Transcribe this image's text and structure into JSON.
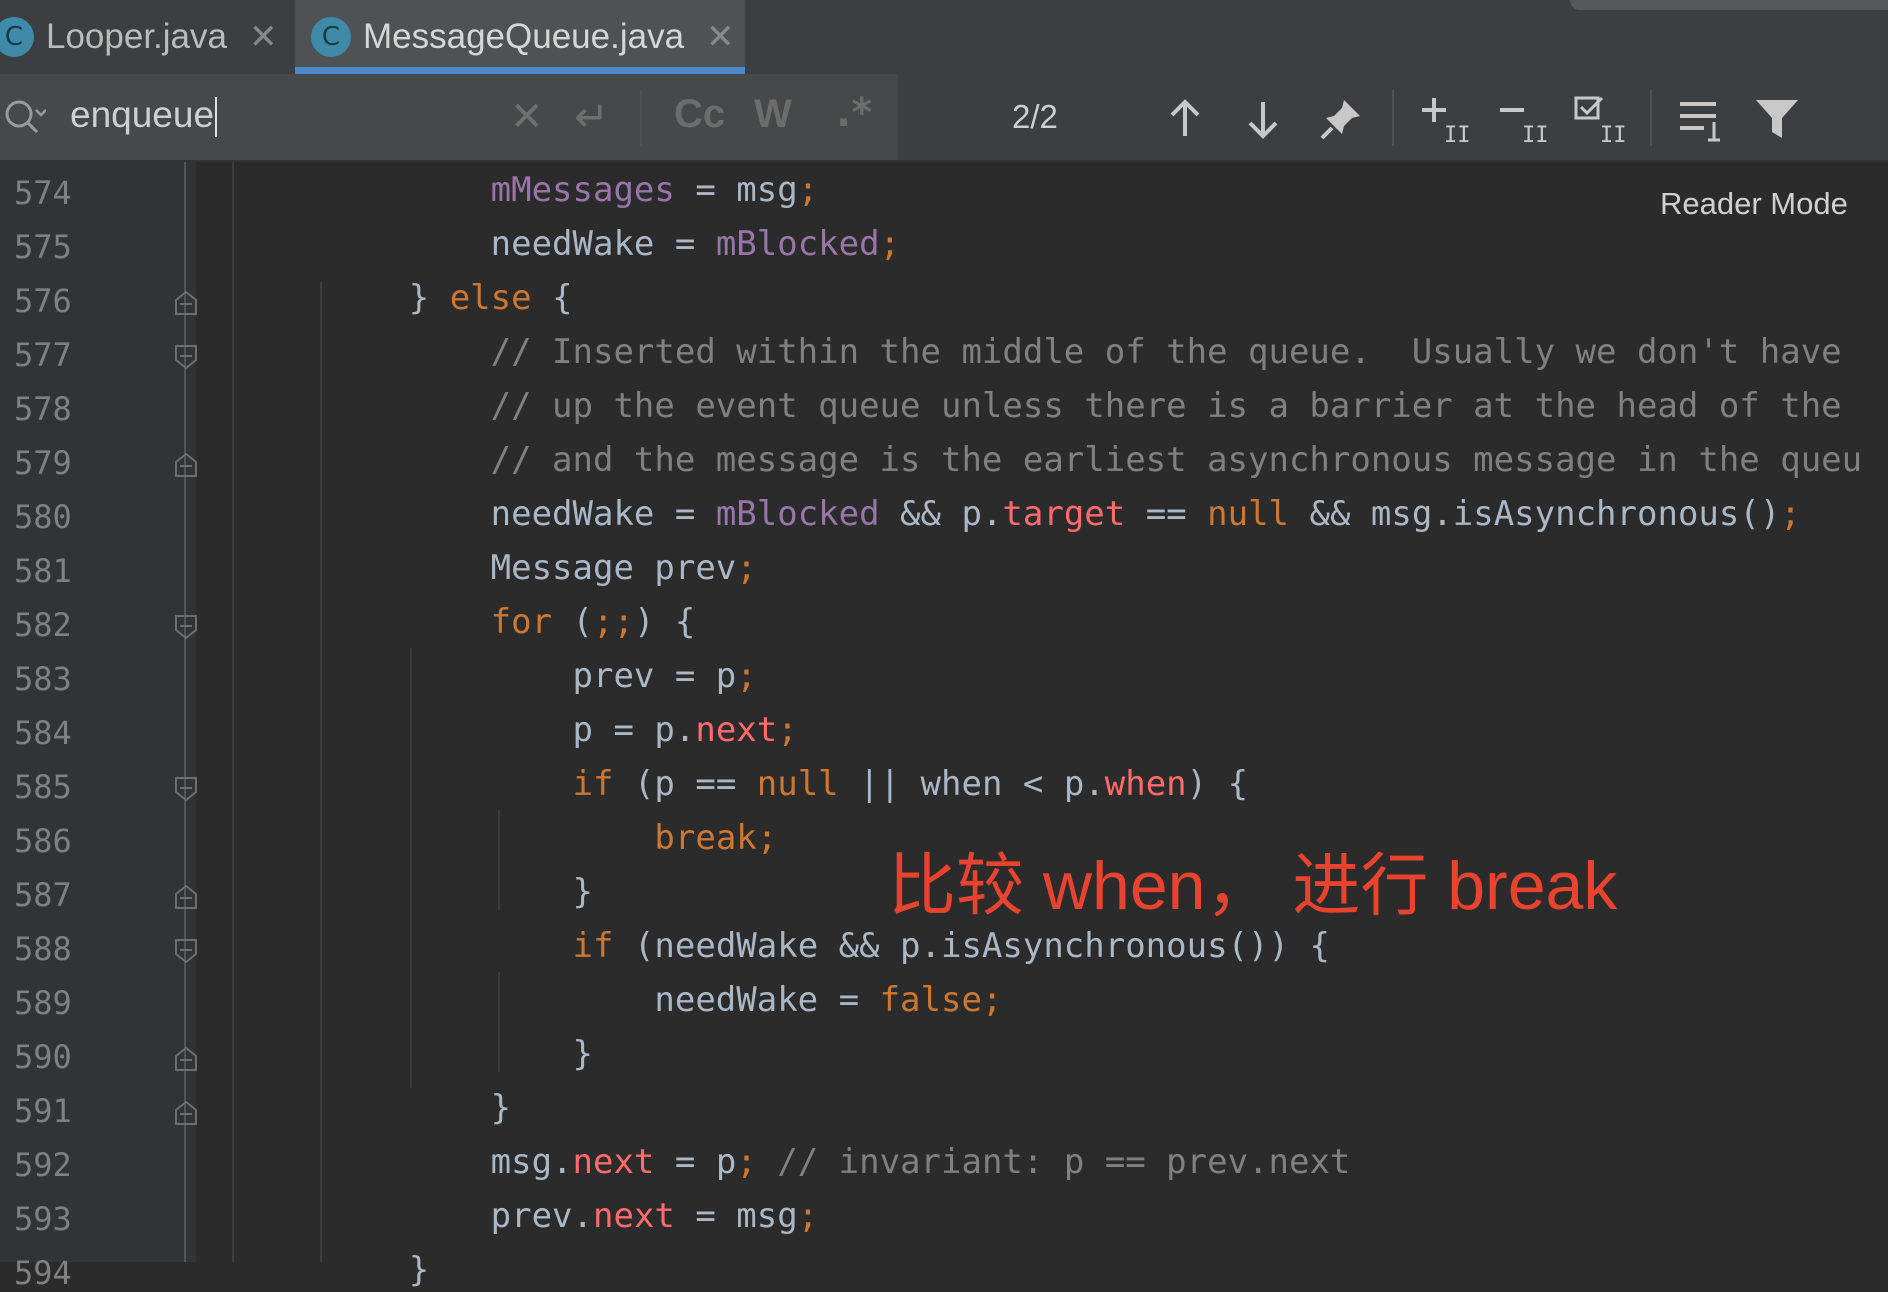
{
  "tabs": [
    {
      "icon": "C",
      "label": "Looper.java"
    },
    {
      "icon": "C",
      "label": "MessageQueue.java"
    }
  ],
  "search": {
    "query": "enqueue",
    "match_case": "Cc",
    "words": "W",
    "regex": ".*",
    "count": "2/2"
  },
  "reader_mode": "Reader Mode",
  "annotation": "比较 when，  进行 break",
  "lines": [
    {
      "n": "574",
      "code": [
        [
          "            ",
          ""
        ],
        [
          "mMessages",
          "fld"
        ],
        [
          " = msg",
          ""
        ],
        [
          ";",
          "kw"
        ]
      ]
    },
    {
      "n": "575",
      "code": [
        [
          "            needWake = ",
          ""
        ],
        [
          "mBlocked",
          "fld"
        ],
        [
          ";",
          "kw"
        ]
      ]
    },
    {
      "n": "576",
      "code": [
        [
          "        } ",
          ""
        ],
        [
          "else",
          "kw"
        ],
        [
          " {",
          ""
        ]
      ]
    },
    {
      "n": "577",
      "code": [
        [
          "            // Inserted within the middle of the queue.  Usually we don't have",
          "cm"
        ]
      ]
    },
    {
      "n": "578",
      "code": [
        [
          "            // up the event queue unless there is a barrier at the head of the",
          "cm"
        ]
      ]
    },
    {
      "n": "579",
      "code": [
        [
          "            // and the message is the earliest asynchronous message in the queu",
          "cm"
        ]
      ]
    },
    {
      "n": "580",
      "code": [
        [
          "            needWake = ",
          ""
        ],
        [
          "mBlocked",
          "fld"
        ],
        [
          " && p.",
          ""
        ],
        [
          "target",
          "pr"
        ],
        [
          " == ",
          ""
        ],
        [
          "null",
          "kw"
        ],
        [
          " && msg.isAsynchronous()",
          ""
        ],
        [
          ";",
          "kw"
        ]
      ]
    },
    {
      "n": "581",
      "code": [
        [
          "            Message prev",
          ""
        ],
        [
          ";",
          "kw"
        ]
      ]
    },
    {
      "n": "582",
      "code": [
        [
          "            ",
          ""
        ],
        [
          "for",
          "kw"
        ],
        [
          " (",
          ""
        ],
        [
          ";;",
          "kw"
        ],
        [
          ") {",
          ""
        ]
      ]
    },
    {
      "n": "583",
      "code": [
        [
          "                prev = p",
          ""
        ],
        [
          ";",
          "kw"
        ]
      ]
    },
    {
      "n": "584",
      "code": [
        [
          "                p = p.",
          ""
        ],
        [
          "next",
          "pr"
        ],
        [
          ";",
          "kw"
        ]
      ]
    },
    {
      "n": "585",
      "code": [
        [
          "                ",
          ""
        ],
        [
          "if",
          "kw"
        ],
        [
          " (p == ",
          ""
        ],
        [
          "null",
          "kw"
        ],
        [
          " || when < p.",
          ""
        ],
        [
          "when",
          "pr"
        ],
        [
          ") {",
          ""
        ]
      ]
    },
    {
      "n": "586",
      "code": [
        [
          "                    ",
          ""
        ],
        [
          "break;",
          "kw"
        ]
      ]
    },
    {
      "n": "587",
      "code": [
        [
          "                }",
          ""
        ]
      ]
    },
    {
      "n": "588",
      "code": [
        [
          "                ",
          ""
        ],
        [
          "if",
          "kw"
        ],
        [
          " (needWake && p.isAsynchronous()) {",
          ""
        ]
      ]
    },
    {
      "n": "589",
      "code": [
        [
          "                    needWake = ",
          ""
        ],
        [
          "false;",
          "kw"
        ]
      ]
    },
    {
      "n": "590",
      "code": [
        [
          "                }",
          ""
        ]
      ]
    },
    {
      "n": "591",
      "code": [
        [
          "            }",
          ""
        ]
      ]
    },
    {
      "n": "592",
      "code": [
        [
          "            msg.",
          ""
        ],
        [
          "next",
          "pr"
        ],
        [
          " = p",
          ""
        ],
        [
          ";",
          "kw"
        ],
        [
          " // invariant: p == prev.next",
          "cm"
        ]
      ]
    },
    {
      "n": "593",
      "code": [
        [
          "            prev.",
          ""
        ],
        [
          "next",
          "pr"
        ],
        [
          " = msg",
          ""
        ],
        [
          ";",
          "kw"
        ]
      ]
    },
    {
      "n": "594",
      "code": [
        [
          "        }",
          ""
        ]
      ]
    }
  ],
  "colors": {
    "background": "#2b2b2b",
    "keyword": "#cc7832",
    "field": "#9876aa",
    "property": "#ff6b6b",
    "comment": "#808080",
    "annotation": "#e8432f",
    "tab_underline": "#4a88c7"
  }
}
